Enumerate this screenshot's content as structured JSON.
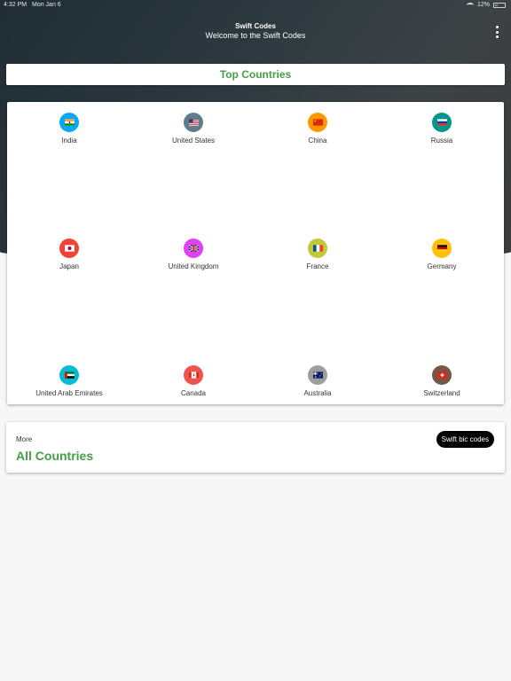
{
  "status_bar": {
    "time": "4:32 PM",
    "date": "Mon Jan 6",
    "battery": "12%"
  },
  "header": {
    "title": "Swift Codes",
    "subtitle": "Welcome to the Swift Codes"
  },
  "top_countries": {
    "title": "Top Countries"
  },
  "countries": [
    {
      "name": "India",
      "color": "#03a9f4",
      "icon": "india-flag-icon"
    },
    {
      "name": "United States",
      "color": "#607d8b",
      "icon": "us-flag-icon"
    },
    {
      "name": "China",
      "color": "#ff9800",
      "icon": "china-flag-icon"
    },
    {
      "name": "Russia",
      "color": "#009688",
      "icon": "russia-flag-icon"
    },
    {
      "name": "Japan",
      "color": "#f44336",
      "icon": "japan-flag-icon"
    },
    {
      "name": "United Kingdom",
      "color": "#e040fb",
      "icon": "uk-flag-icon"
    },
    {
      "name": "France",
      "color": "#c0ca33",
      "icon": "france-flag-icon"
    },
    {
      "name": "Germany",
      "color": "#ffc107",
      "icon": "germany-flag-icon"
    },
    {
      "name": "United Arab Emirates",
      "color": "#00bcd4",
      "icon": "uae-flag-icon"
    },
    {
      "name": "Canada",
      "color": "#ef5350",
      "icon": "canada-flag-icon"
    },
    {
      "name": "Australia",
      "color": "#9e9e9e",
      "icon": "australia-flag-icon"
    },
    {
      "name": "Switzerland",
      "color": "#795548",
      "icon": "switzerland-flag-icon"
    }
  ],
  "more": {
    "label": "More",
    "title": "All Countries",
    "button": "Swift bic codes"
  }
}
